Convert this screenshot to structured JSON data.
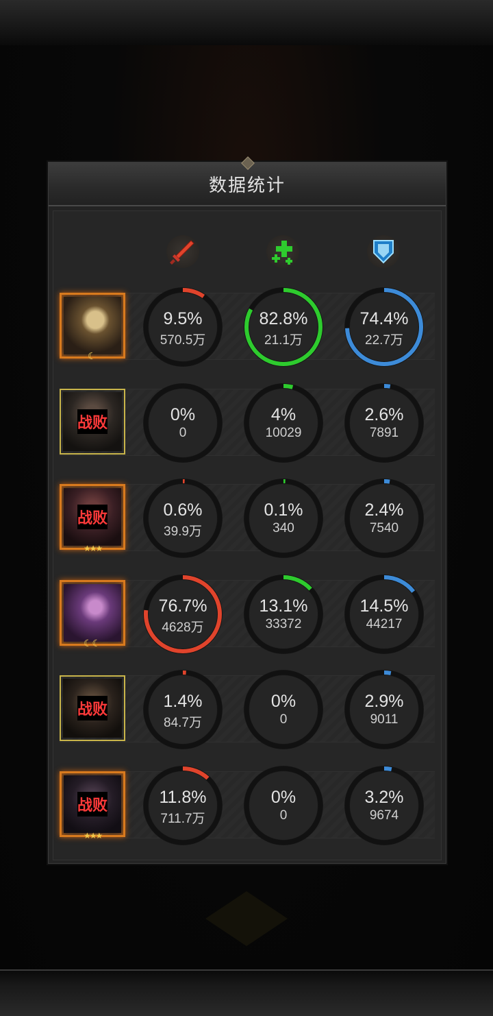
{
  "panel": {
    "title": "数据统计"
  },
  "columns": [
    {
      "icon": "damage-sword-icon",
      "color": "#e0442c"
    },
    {
      "icon": "heal-cross-icon",
      "color": "#2ecb2e"
    },
    {
      "icon": "defense-shield-icon",
      "color": "#3d8bd8"
    }
  ],
  "colors": {
    "damage": "#e0442c",
    "heal": "#2ecb2e",
    "shield": "#3d8bd8",
    "defeated": "#ff3a3a"
  },
  "rows": [
    {
      "hero": "hero-1",
      "defeated_label": "",
      "stats": [
        {
          "pct": "9.5%",
          "amount": "570.5万",
          "fraction": 0.095
        },
        {
          "pct": "82.8%",
          "amount": "21.1万",
          "fraction": 0.828
        },
        {
          "pct": "74.4%",
          "amount": "22.7万",
          "fraction": 0.744
        }
      ]
    },
    {
      "hero": "hero-2",
      "defeated_label": "战败",
      "stats": [
        {
          "pct": "0%",
          "amount": "0",
          "fraction": 0
        },
        {
          "pct": "4%",
          "amount": "10029",
          "fraction": 0.04
        },
        {
          "pct": "2.6%",
          "amount": "7891",
          "fraction": 0.026
        }
      ]
    },
    {
      "hero": "hero-3",
      "defeated_label": "战败",
      "stats": [
        {
          "pct": "0.6%",
          "amount": "39.9万",
          "fraction": 0.006
        },
        {
          "pct": "0.1%",
          "amount": "340",
          "fraction": 0.001
        },
        {
          "pct": "2.4%",
          "amount": "7540",
          "fraction": 0.024
        }
      ]
    },
    {
      "hero": "hero-4",
      "defeated_label": "",
      "stats": [
        {
          "pct": "76.7%",
          "amount": "4628万",
          "fraction": 0.767
        },
        {
          "pct": "13.1%",
          "amount": "33372",
          "fraction": 0.131
        },
        {
          "pct": "14.5%",
          "amount": "44217",
          "fraction": 0.145
        }
      ]
    },
    {
      "hero": "hero-5",
      "defeated_label": "战败",
      "stats": [
        {
          "pct": "1.4%",
          "amount": "84.7万",
          "fraction": 0.014
        },
        {
          "pct": "0%",
          "amount": "0",
          "fraction": 0
        },
        {
          "pct": "2.9%",
          "amount": "9011",
          "fraction": 0.029
        }
      ]
    },
    {
      "hero": "hero-6",
      "defeated_label": "战败",
      "stats": [
        {
          "pct": "11.8%",
          "amount": "711.7万",
          "fraction": 0.118
        },
        {
          "pct": "0%",
          "amount": "0",
          "fraction": 0
        },
        {
          "pct": "3.2%",
          "amount": "9674",
          "fraction": 0.032
        }
      ]
    }
  ]
}
